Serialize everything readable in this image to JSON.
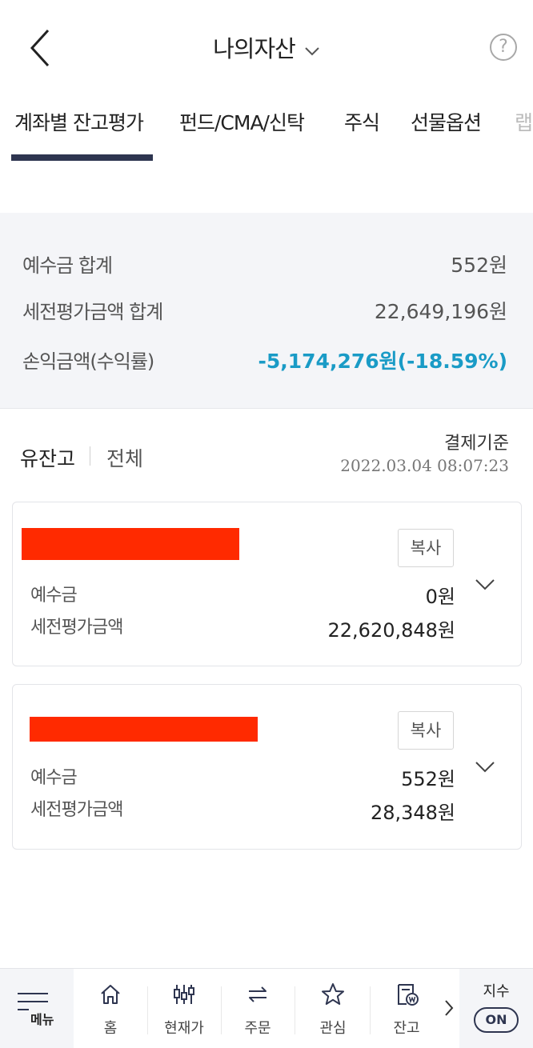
{
  "header": {
    "title": "나의자산",
    "icons": {
      "back": "chevron-left-icon",
      "dropdown": "chevron-down-icon",
      "help": "help-circle-icon"
    },
    "help_glyph": "?"
  },
  "tabs": [
    {
      "label": "계좌별 잔고평가",
      "active": true
    },
    {
      "label": "펀드/CMA/신탁",
      "active": false
    },
    {
      "label": "주식",
      "active": false
    },
    {
      "label": "선물옵션",
      "active": false
    },
    {
      "label": "랩",
      "active": false
    }
  ],
  "summary": {
    "deposit_label": "예수금 합계",
    "deposit_value": "552원",
    "eval_label": "세전평가금액 합계",
    "eval_value": "22,649,196원",
    "pl_label": "손익금액(수익률)",
    "pl_value": "-5,174,276원(-18.59%)",
    "pl_color": "#1a9bc6"
  },
  "filter": {
    "own_label": "유잔고",
    "all_label": "전체",
    "basis_label": "결제기준",
    "basis_time": "2022.03.04 08:07:23"
  },
  "accounts": [
    {
      "copy_label": "복사",
      "deposit_label": "예수금",
      "deposit_value": "0원",
      "eval_label": "세전평가금액",
      "eval_value": "22,620,848원"
    },
    {
      "copy_label": "복사",
      "deposit_label": "예수금",
      "deposit_value": "552원",
      "eval_label": "세전평가금액",
      "eval_value": "28,348원"
    }
  ],
  "redaction_color": "#ff2a00",
  "bottom_nav": {
    "menu_label": "메뉴",
    "items": [
      {
        "label": "홈",
        "icon": "home-icon"
      },
      {
        "label": "현재가",
        "icon": "candlestick-icon"
      },
      {
        "label": "주문",
        "icon": "swap-icon"
      },
      {
        "label": "관심",
        "icon": "star-icon"
      },
      {
        "label": "잔고",
        "icon": "balance-icon"
      }
    ],
    "index_label": "지수",
    "index_toggle": "ON"
  },
  "accent_color": "#2e3550"
}
